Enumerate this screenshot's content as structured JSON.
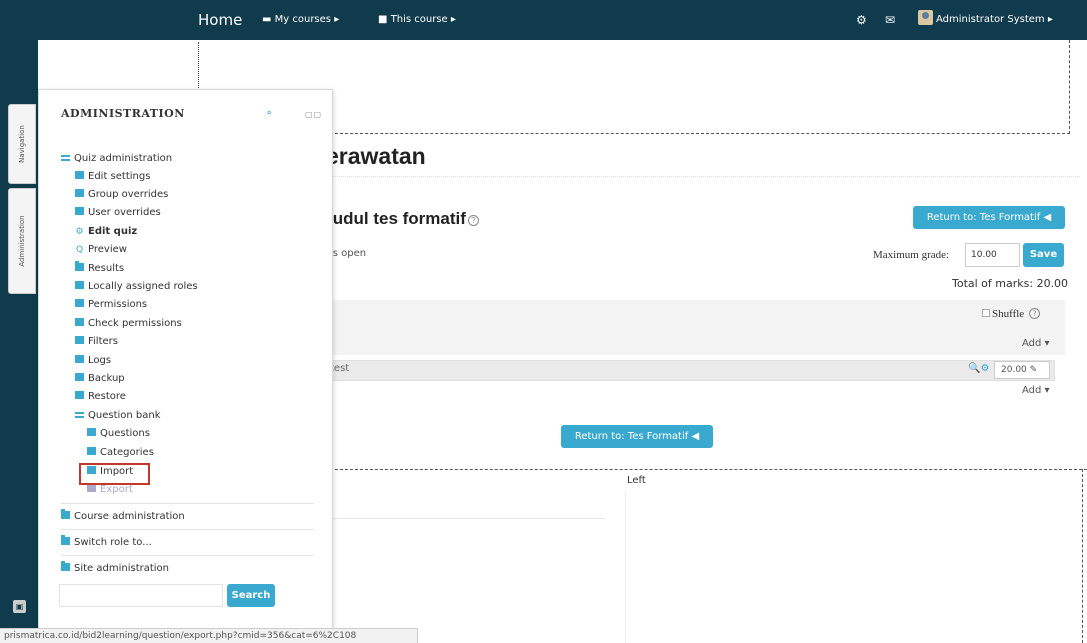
{
  "navbar": {
    "home": "Home",
    "my_courses": "My courses",
    "this_course": "This course",
    "user": "Administrator System",
    "gear_glyph": "⚙",
    "mail_glyph": "✉",
    "caret": "▸",
    "bg_color": "#0f3b4d"
  },
  "sidetabs": {
    "navigation": "Navigation",
    "administration": "Administration"
  },
  "main": {
    "page_title": "erawatan",
    "quiz_heading": "judul tes formatif",
    "return_label": "Return to: Tes Formatif",
    "is_open": "is open",
    "max_grade_label": "Maximum grade:",
    "max_grade_value": "10.00",
    "save_label": "Save",
    "total_marks": "Total of marks: 20.00",
    "shuffle_label": "Shuffle",
    "add_label": "Add",
    "question_name": "test",
    "question_mark": "20.00",
    "left_label": "Left",
    "accent_color": "#3aa9cf"
  },
  "admin": {
    "title": "ADMINISTRATION",
    "search_label": "Search",
    "items": [
      {
        "label": "Quiz administration",
        "icon": "folder-open-icon"
      },
      {
        "label": "Edit settings",
        "icon": "page-icon"
      },
      {
        "label": "Group overrides",
        "icon": "page-icon"
      },
      {
        "label": "User overrides",
        "icon": "page-icon"
      },
      {
        "label": "Edit quiz",
        "icon": "gear-icon"
      },
      {
        "label": "Preview",
        "icon": "magnifier-icon"
      },
      {
        "label": "Results",
        "icon": "folder-icon"
      },
      {
        "label": "Locally assigned roles",
        "icon": "page-icon"
      },
      {
        "label": "Permissions",
        "icon": "page-icon"
      },
      {
        "label": "Check permissions",
        "icon": "page-icon"
      },
      {
        "label": "Filters",
        "icon": "page-icon"
      },
      {
        "label": "Logs",
        "icon": "page-icon"
      },
      {
        "label": "Backup",
        "icon": "page-icon"
      },
      {
        "label": "Restore",
        "icon": "page-icon"
      },
      {
        "label": "Question bank",
        "icon": "folder-open-icon"
      },
      {
        "label": "Questions",
        "icon": "page-icon"
      },
      {
        "label": "Categories",
        "icon": "page-icon"
      },
      {
        "label": "Import",
        "icon": "page-icon"
      },
      {
        "label": "Export",
        "icon": "page-icon"
      },
      {
        "label": "Course administration",
        "icon": "folder-icon"
      },
      {
        "label": "Switch role to...",
        "icon": "folder-icon"
      },
      {
        "label": "Site administration",
        "icon": "folder-icon"
      }
    ]
  },
  "statusbar": {
    "url": "prismatrica.co.id/bid2learning/question/export.php?cmid=356&cat=6%2C108"
  }
}
